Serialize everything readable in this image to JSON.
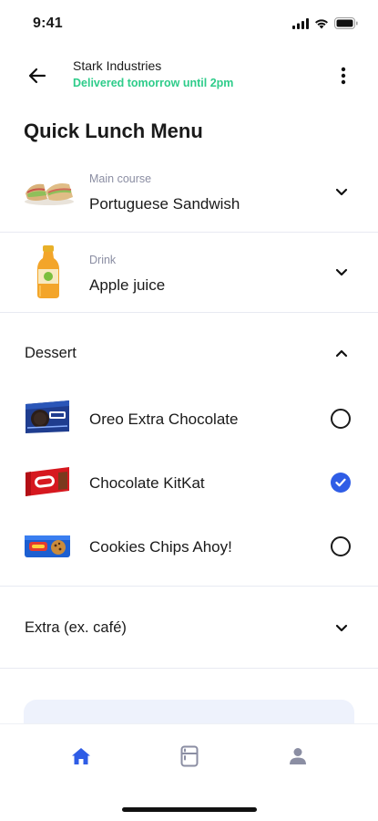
{
  "status": {
    "time": "9:41"
  },
  "header": {
    "store_name": "Stark Industries",
    "delivery_note": "Delivered tomorrow until 2pm"
  },
  "page": {
    "title": "Quick Lunch Menu"
  },
  "main_course": {
    "category": "Main course",
    "selected": "Portuguese Sandwish"
  },
  "drink": {
    "category": "Drink",
    "selected": "Apple juice"
  },
  "dessert": {
    "label": "Dessert",
    "expanded": true,
    "options": [
      {
        "label": "Oreo Extra Chocolate",
        "selected": false
      },
      {
        "label": "Chocolate KitKat",
        "selected": true
      },
      {
        "label": "Cookies Chips Ahoy!",
        "selected": false
      }
    ]
  },
  "extra": {
    "label": "Extra (ex. café)"
  },
  "tabs": [
    {
      "icon": "home-icon",
      "active": true
    },
    {
      "icon": "fridge-icon",
      "active": false
    },
    {
      "icon": "user-icon",
      "active": false
    }
  ],
  "colors": {
    "accent": "#2f5de6",
    "delivery": "#2ecc8a",
    "divider": "#e8eaf2",
    "muted": "#8b8ea3"
  }
}
